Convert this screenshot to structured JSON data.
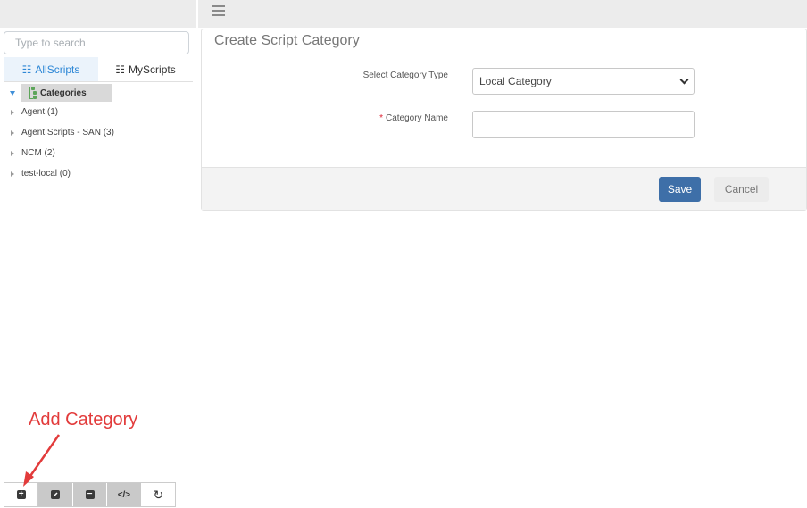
{
  "sidebar": {
    "search_placeholder": "Type to search",
    "tabs": [
      {
        "label": "AllScripts",
        "icon": "list-icon",
        "active": true
      },
      {
        "label": "MyScripts",
        "icon": "list-icon",
        "active": false
      }
    ],
    "tree": {
      "root_label": "Categories",
      "items": [
        {
          "label": "Agent (1)"
        },
        {
          "label": "Agent Scripts - SAN (3)"
        },
        {
          "label": "NCM (2)"
        },
        {
          "label": "test-local (0)"
        }
      ]
    },
    "toolbar": [
      {
        "icon": "add-square-icon",
        "glyph": "+"
      },
      {
        "icon": "edit-square-icon"
      },
      {
        "icon": "minus-square-icon",
        "glyph": "−"
      },
      {
        "icon": "code-icon",
        "glyph": "</>"
      },
      {
        "icon": "refresh-icon",
        "glyph": "↻"
      }
    ],
    "annotation": "Add Category"
  },
  "main": {
    "menu_icon": "hamburger-icon",
    "title": "Create Script Category",
    "form": {
      "category_type_label": "Select Category Type",
      "category_type_value": "Local Category",
      "category_name_label": "Category Name",
      "required_marker": "*",
      "category_name_value": ""
    },
    "buttons": {
      "save": "Save",
      "cancel": "Cancel"
    }
  },
  "colors": {
    "accent": "#2d87d6",
    "primary_button": "#3e6fa8",
    "annotation": "#e23b3b"
  }
}
